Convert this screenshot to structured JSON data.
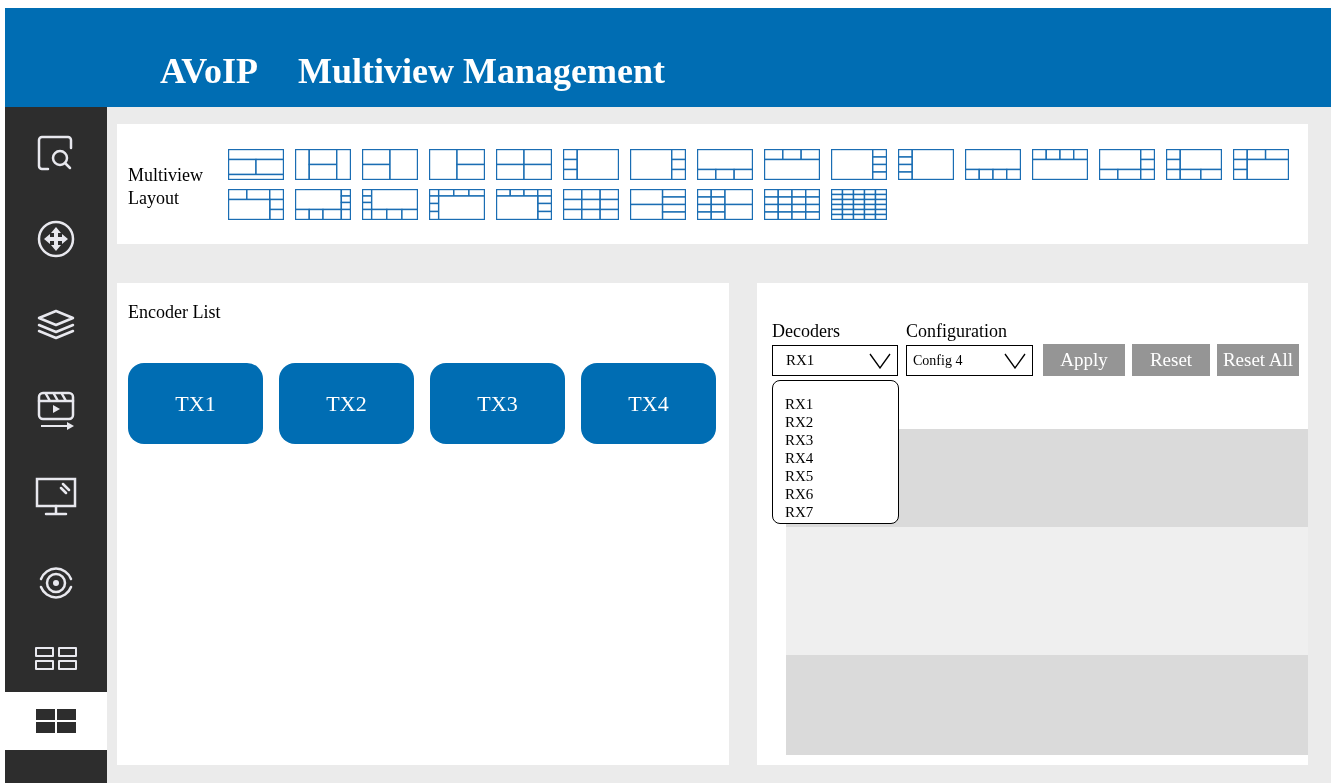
{
  "header": {
    "brand": "AVoIP",
    "title": "Multiview Management"
  },
  "sidebar": {
    "items": [
      {
        "kind": "search",
        "selected": false
      },
      {
        "kind": "move",
        "selected": false
      },
      {
        "kind": "layers",
        "selected": false
      },
      {
        "kind": "video",
        "selected": false
      },
      {
        "kind": "monitor",
        "selected": false
      },
      {
        "kind": "target",
        "selected": false
      },
      {
        "kind": "tiles",
        "selected": false
      },
      {
        "kind": "multiview",
        "selected": true
      }
    ]
  },
  "layout_panel": {
    "label": "Multiview Layout"
  },
  "encoders": {
    "title": "Encoder List",
    "items": [
      "TX1",
      "TX2",
      "TX3",
      "TX4"
    ]
  },
  "decoders": {
    "label": "Decoders",
    "value": "RX1",
    "expanded": true,
    "options": [
      "RX1",
      "RX2",
      "RX3",
      "RX4",
      "RX5",
      "RX6",
      "RX7"
    ]
  },
  "configuration": {
    "label": "Configuration",
    "value": "Config 4"
  },
  "actions": [
    {
      "label": "Apply",
      "disabled": true
    },
    {
      "label": "Reset",
      "disabled": true
    },
    {
      "label": "Reset All",
      "disabled": true
    }
  ]
}
